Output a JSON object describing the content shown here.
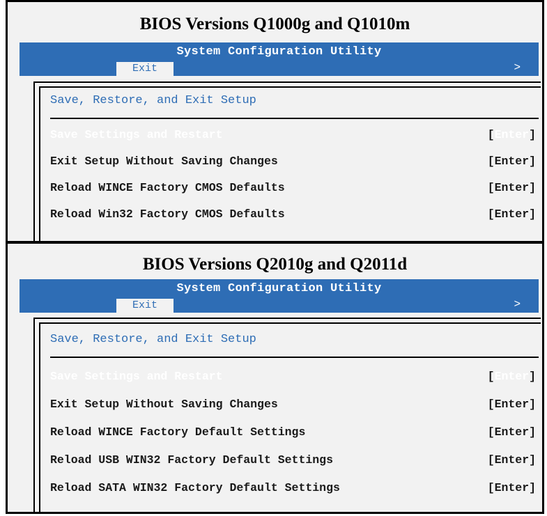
{
  "panels": [
    {
      "title": "BIOS Versions Q1000g and Q1010m",
      "utility_title": "System Configuration Utility",
      "tab": "Exit",
      "arrow": ">",
      "section": "Save, Restore, and Exit Setup",
      "items": [
        {
          "label": "Save Settings and Restart",
          "key": "Enter",
          "selected": true
        },
        {
          "label": "Exit Setup Without Saving Changes",
          "key": "[Enter]"
        },
        {
          "label": "Reload WINCE Factory CMOS Defaults",
          "key": "[Enter]"
        },
        {
          "label": "Reload Win32 Factory CMOS Defaults",
          "key": "[Enter]"
        }
      ]
    },
    {
      "title": "BIOS Versions Q2010g and Q2011d",
      "utility_title": "System Configuration Utility",
      "tab": "Exit",
      "arrow": ">",
      "section": "Save, Restore, and Exit Setup",
      "items": [
        {
          "label": "Save Settings and Restart",
          "key": "Enter",
          "selected": true
        },
        {
          "label": "Exit Setup Without Saving Changes",
          "key": "[Enter]"
        },
        {
          "label": "Reload WINCE Factory Default Settings",
          "key": "[Enter]"
        },
        {
          "label": "Reload USB WIN32 Factory Default Settings",
          "key": "[Enter]"
        },
        {
          "label": "Reload SATA WIN32 Factory Default Settings",
          "key": "[Enter]"
        }
      ]
    }
  ],
  "colors": {
    "banner": "#2e6db5",
    "background": "#f2f2f2"
  }
}
